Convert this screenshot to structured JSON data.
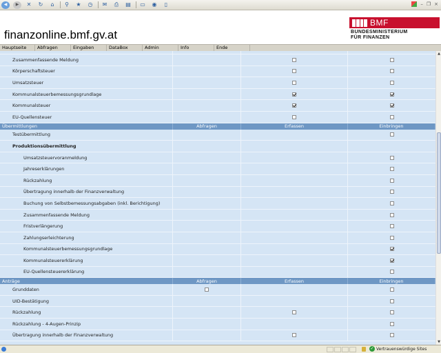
{
  "browser": {
    "toolbar_icons": [
      "back-icon",
      "forward-icon",
      "stop-icon",
      "refresh-icon",
      "home-icon",
      "search-icon",
      "favorites-icon",
      "history-icon",
      "mail-icon",
      "print-icon",
      "edit-icon",
      "discuss-icon",
      "messenger-icon",
      "research-icon"
    ]
  },
  "header": {
    "site_title": "finanzonline.bmf.gv.at",
    "logo_text": "BMF",
    "logo_line1": "BUNDESMINISTERIUM",
    "logo_line2": "FÜR FINANZEN",
    "brand_color": "#c8102e"
  },
  "nav": {
    "items": [
      "Hauptseite",
      "Abfragen",
      "Eingaben",
      "DataBox",
      "Admin",
      "Info",
      "Ende"
    ]
  },
  "table": {
    "rows_top": [
      {
        "label": "Zusammenfassende Meldung",
        "c3": "unchecked",
        "c4": "unchecked"
      },
      {
        "label": "Körperschaftsteuer",
        "c3": "unchecked",
        "c4": "unchecked"
      },
      {
        "label": "Umsatzsteuer",
        "c3": "unchecked",
        "c4": "unchecked"
      },
      {
        "label": "Kommunalsteuerbemessungsgrundlage",
        "c3": "checked",
        "c4": "checked"
      },
      {
        "label": "Kommunalsteuer",
        "c3": "checked",
        "c4": "checked"
      },
      {
        "label": "EU-Quellensteuer",
        "c3": "unchecked",
        "c4": "unchecked"
      }
    ],
    "section_uebermittlungen": {
      "title": "Übermittlungen",
      "col_abfragen": "Abfragen",
      "col_erfassen": "Erfassen",
      "col_einbringen": "Einbringen"
    },
    "rows_uebermittlungen": [
      {
        "label": "Testübermittlung",
        "c4": "unchecked"
      },
      {
        "label": "Produktionsübermittlung",
        "bold": true
      }
    ],
    "rows_produktion": [
      {
        "label": "Umsatzsteuervoranmeldung",
        "c4": "unchecked"
      },
      {
        "label": "Jahreserklärungen",
        "c4": "unchecked"
      },
      {
        "label": "Rückzahlung",
        "c4": "unchecked"
      },
      {
        "label": "Übertragung innerhalb der Finanzverwaltung",
        "c4": "unchecked"
      },
      {
        "label": "Buchung von Selbstbemessungsabgaben (inkl. Berichtigung)",
        "c4": "unchecked"
      },
      {
        "label": "Zusammenfassende Meldung",
        "c4": "unchecked"
      },
      {
        "label": "Fristverlängerung",
        "c4": "unchecked"
      },
      {
        "label": "Zahlungserleichterung",
        "c4": "unchecked"
      },
      {
        "label": "Kommunalsteuerbemessungsgrundlage",
        "c4": "checked"
      },
      {
        "label": "Kommunalsteuererklärung",
        "c4": "checked"
      },
      {
        "label": "EU-Quellensteuererklärung",
        "c4": "unchecked"
      }
    ],
    "section_antraege": {
      "title": "Anträge",
      "col_abfragen": "Abfragen",
      "col_erfassen": "Erfassen",
      "col_einbringen": "Einbringen"
    },
    "rows_antraege": [
      {
        "label": "Grunddaten",
        "c2": "unchecked",
        "c4": "unchecked"
      },
      {
        "label": "UID-Bestätigung",
        "c4": "unchecked"
      },
      {
        "label": "Rückzahlung",
        "c3": "unchecked",
        "c4": "unchecked"
      },
      {
        "label": "Rückzahlung - 4-Augen-Prinzip",
        "c4": "unchecked"
      },
      {
        "label": "Übertragung innerhalb der Finanzverwaltung",
        "c3": "unchecked",
        "c4": "unchecked"
      }
    ]
  },
  "statusbar": {
    "zone_label": "Vertrauenswürdige Sites"
  }
}
